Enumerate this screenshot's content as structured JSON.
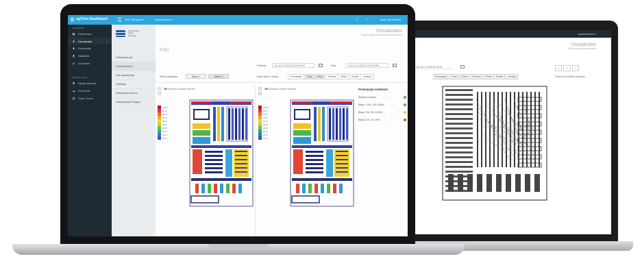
{
  "back_laptop": {
    "topbar_user": "administrator ▾",
    "title": "Vizualizator",
    "subtitle": "Brzi pregled prehodenosti",
    "date_value": "Tue Jul 07 2020 01:00:00",
    "chips": [
      "Ponedeljak",
      "Torak",
      "Sreda",
      "Četvrtak",
      "Petak",
      "Subota",
      "Nedelja"
    ],
    "pager": [
      "<",
      "1",
      ">"
    ],
    "pager_note": "Pritisni na različite odsekove"
  },
  "nav": {
    "brand": "ogiTron Dashboard",
    "dropdown1": "RMF Beograd ▾",
    "dropdown2": "Bankovšćina ▾",
    "user": "Jadro Upravitelj ▾",
    "icons": [
      "expand-icon",
      "bell-icon"
    ]
  },
  "sidebar": {
    "section1": "Navigacija",
    "items1": [
      {
        "icon": "dashboard-icon",
        "glyph": "▣",
        "label": "Dashboard"
      },
      {
        "icon": "pin-icon",
        "glyph": "●",
        "label": "Vizualizator",
        "active": true
      },
      {
        "icon": "person-icon",
        "glyph": "♟",
        "label": "Kompanije"
      },
      {
        "icon": "chart-icon",
        "glyph": "▮",
        "label": "Statistika"
      },
      {
        "icon": "ai-icon",
        "glyph": "◎",
        "label": "AI Analize"
      }
    ],
    "section2": "Konfiguracija",
    "items2": [
      {
        "icon": "settings-icon",
        "glyph": "✱",
        "label": "Stanje sistema"
      },
      {
        "icon": "cloud-icon",
        "glyph": "☁",
        "label": "Kontrolna"
      },
      {
        "icon": "trash-icon",
        "glyph": "▤",
        "label": "Uvoz / Izvoz"
      }
    ]
  },
  "subpanel": {
    "logo_text": [
      "Leeturatsuse",
      "Veliko",
      "Kolorenje"
    ],
    "items": [
      "Posmatrani puti",
      "Gotal prehodno",
      "Čas zadržavanja",
      "Heatmap",
      "Sinhronizuj domenu",
      "Zaključavanje Shopper"
    ],
    "active_index": 1
  },
  "main": {
    "title": "Vizualizator",
    "subtitle": "Pogled prehodnosti kupaca na Bratnu",
    "filter_title": "Filtri",
    "pocetak_label": "Početak:",
    "pocetak_value": "Tue Jul 07 2020 01:00:00 GMT",
    "kraj_label": "Kraj:",
    "kraj_value": "Tue Jul 07 2020 01:00:00 GMT",
    "prikaz_label": "Prikaz podataka:",
    "prikaz_opts": [
      "Mesto 1",
      "Mesto 2"
    ],
    "dan_label": "Izberi dane u tedna:",
    "days": [
      "Ponedeljak",
      "Torak",
      "Sreda",
      "Četvrtak",
      "Petak",
      "Subota",
      "Nedelja"
    ],
    "selected_days": [
      1,
      2
    ],
    "map_info_count": "200",
    "map_info_text": "prehodna u danom intervalu",
    "legend": [
      {
        "label": "100 %",
        "color": "#c4122f"
      },
      {
        "label": "90 %",
        "color": "#e0352f"
      },
      {
        "label": "80 %",
        "color": "#ef6b2e"
      },
      {
        "label": "70 %",
        "color": "#f4a321"
      },
      {
        "label": "60 %",
        "color": "#f6d325"
      },
      {
        "label": "50 %",
        "color": "#b9d633"
      },
      {
        "label": "40 %",
        "color": "#6cc04a"
      },
      {
        "label": "30 %",
        "color": "#23a8a0"
      },
      {
        "label": "20 %",
        "color": "#2a7ec4"
      },
      {
        "label": "10 %",
        "color": "#4a4cbd"
      }
    ],
    "right_panel": {
      "title": "Primerjanje vrednosti",
      "rows": [
        {
          "label": "Blagovno skupina",
          "color": "#4caf50"
        },
        {
          "label": "Blago 1  104 / 120 (+65%)",
          "color": "#4caf50"
        },
        {
          "label": "Blago 2  98 / 96 (+4,8%)",
          "color": "#f4c542"
        },
        {
          "label": "Blago 3  20 / 24 (-9%)",
          "color": "#e04b3a"
        }
      ]
    }
  }
}
